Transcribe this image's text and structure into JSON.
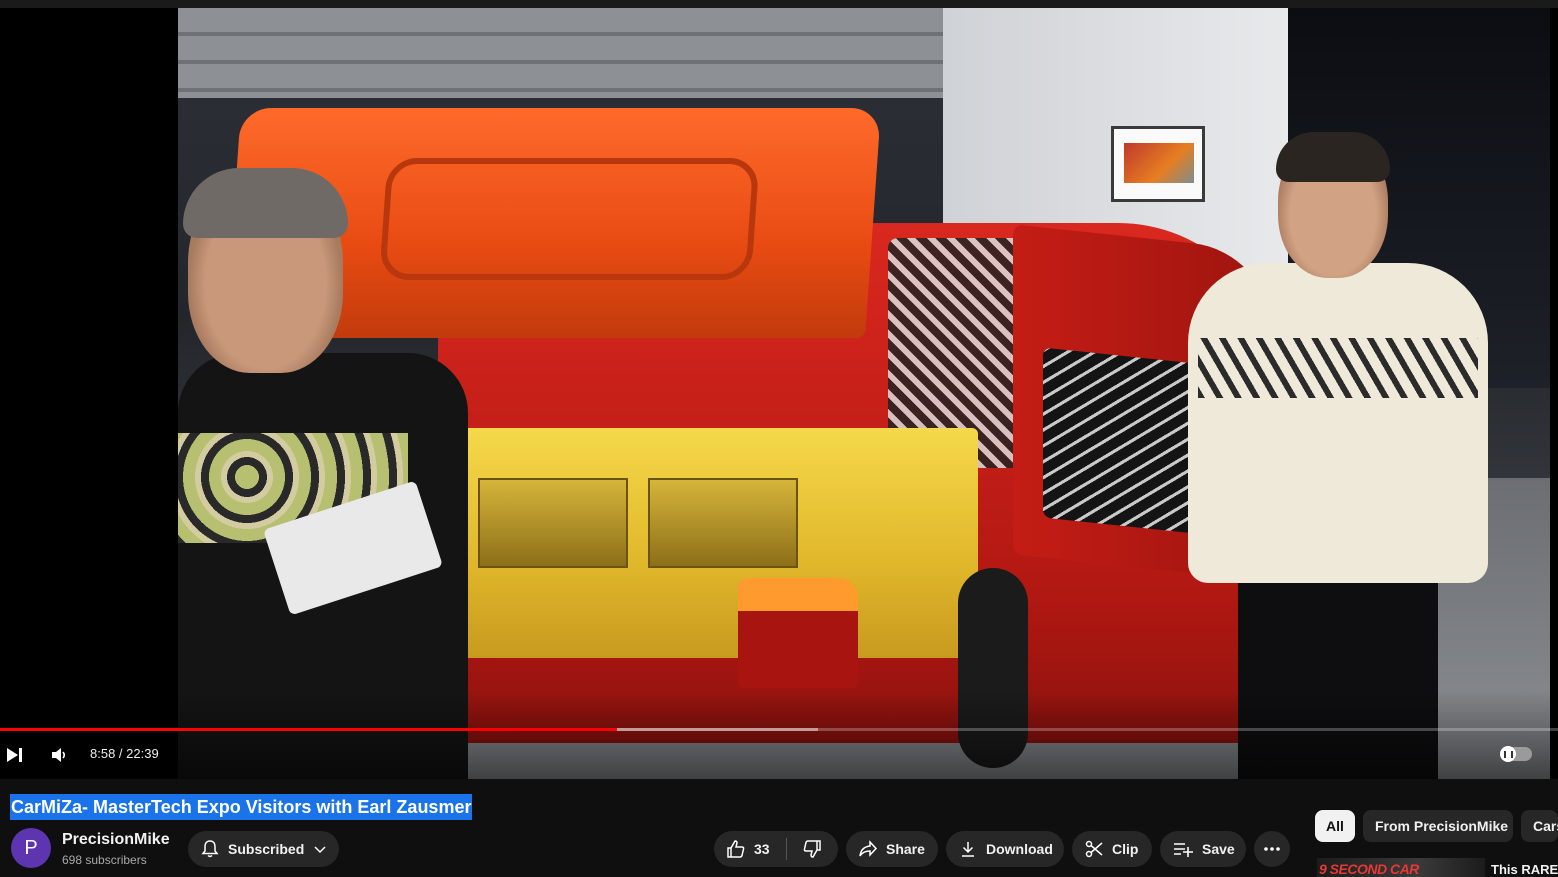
{
  "player": {
    "time_display": "8:58 / 22:39",
    "progress_played": 0.396,
    "progress_buffered": 0.525,
    "autoplay_on": false
  },
  "video": {
    "title": "CarMiZa- MasterTech Expo Visitors with Earl Zausmer"
  },
  "channel": {
    "avatar_letter": "P",
    "name": "PrecisionMike",
    "subscribers": "698 subscribers",
    "subscribe_label": "Subscribed"
  },
  "actions": {
    "like_count": "33",
    "share_label": "Share",
    "download_label": "Download",
    "clip_label": "Clip",
    "save_label": "Save"
  },
  "chips": {
    "all": "All",
    "from_channel": "From PrecisionMike",
    "cars": "Cars"
  },
  "recommendation": {
    "thumb_text": "9 SECOND CAR",
    "title": "This RARE"
  },
  "colors": {
    "progress_red": "#ff0000",
    "title_highlight": "#1a73e8",
    "avatar": "#5e35b1"
  },
  "icons": [
    "next-icon",
    "volume-icon",
    "autoplay-toggle",
    "bell-icon",
    "chevron-down-icon",
    "thumbs-up-icon",
    "thumbs-down-icon",
    "share-icon",
    "download-icon",
    "scissors-icon",
    "playlist-add-icon",
    "more-icon"
  ]
}
